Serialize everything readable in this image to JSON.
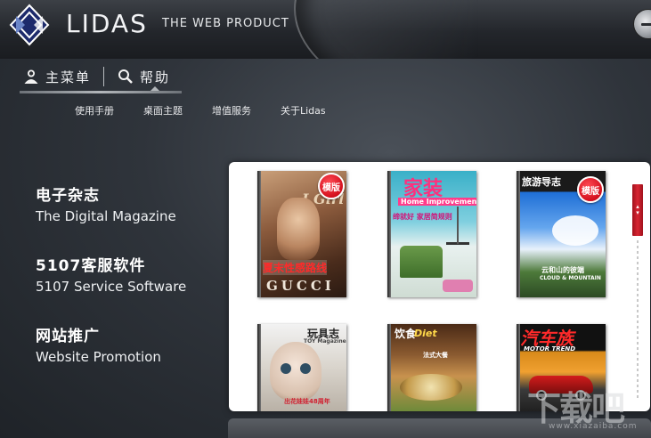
{
  "header": {
    "brand": "LIDAS",
    "tagline": "THE WEB PRODUCT",
    "logo_icon": "lidas-diamond-logo"
  },
  "nav": {
    "main_menu": "主菜单",
    "help": "帮助",
    "main_menu_icon": "user-icon",
    "help_icon": "search-icon"
  },
  "subnav": {
    "items": [
      "使用手册",
      "桌面主题",
      "增值服务",
      "关于Lidas"
    ]
  },
  "categories": [
    {
      "zh": "电子杂志",
      "en": "The Digital Magazine"
    },
    {
      "zh": "5107客服软件",
      "en": "5107 Service Software"
    },
    {
      "zh": "网站推广",
      "en": "Website Promotion"
    }
  ],
  "magazines": [
    {
      "title": "I Girl",
      "cover_text": "夏末性感路线",
      "footer_text": "GUCCI",
      "badge": "模版"
    },
    {
      "title": "家装",
      "subtitle": "Home Improvement",
      "cover_text": "缔就好 家居简规则",
      "badge": ""
    },
    {
      "title": "旅游导志",
      "subtitle": "云和山的彼端",
      "footer_text": "CLOUD & MOUNTAIN",
      "badge": "模版"
    },
    {
      "title": "玩具志",
      "subtitle": "TOY Magazine",
      "footer_text": "出花娃娃48周年"
    },
    {
      "title": "饮食",
      "subtitle": "Diet",
      "cover_text": "法式大餐"
    },
    {
      "title": "汽车族",
      "subtitle": "MOTOR TREND"
    }
  ],
  "watermark": {
    "big": "下载吧",
    "small": "www.xiazaiba.com"
  },
  "colors": {
    "accent_red": "#d4101e",
    "background": "#2f343b"
  }
}
